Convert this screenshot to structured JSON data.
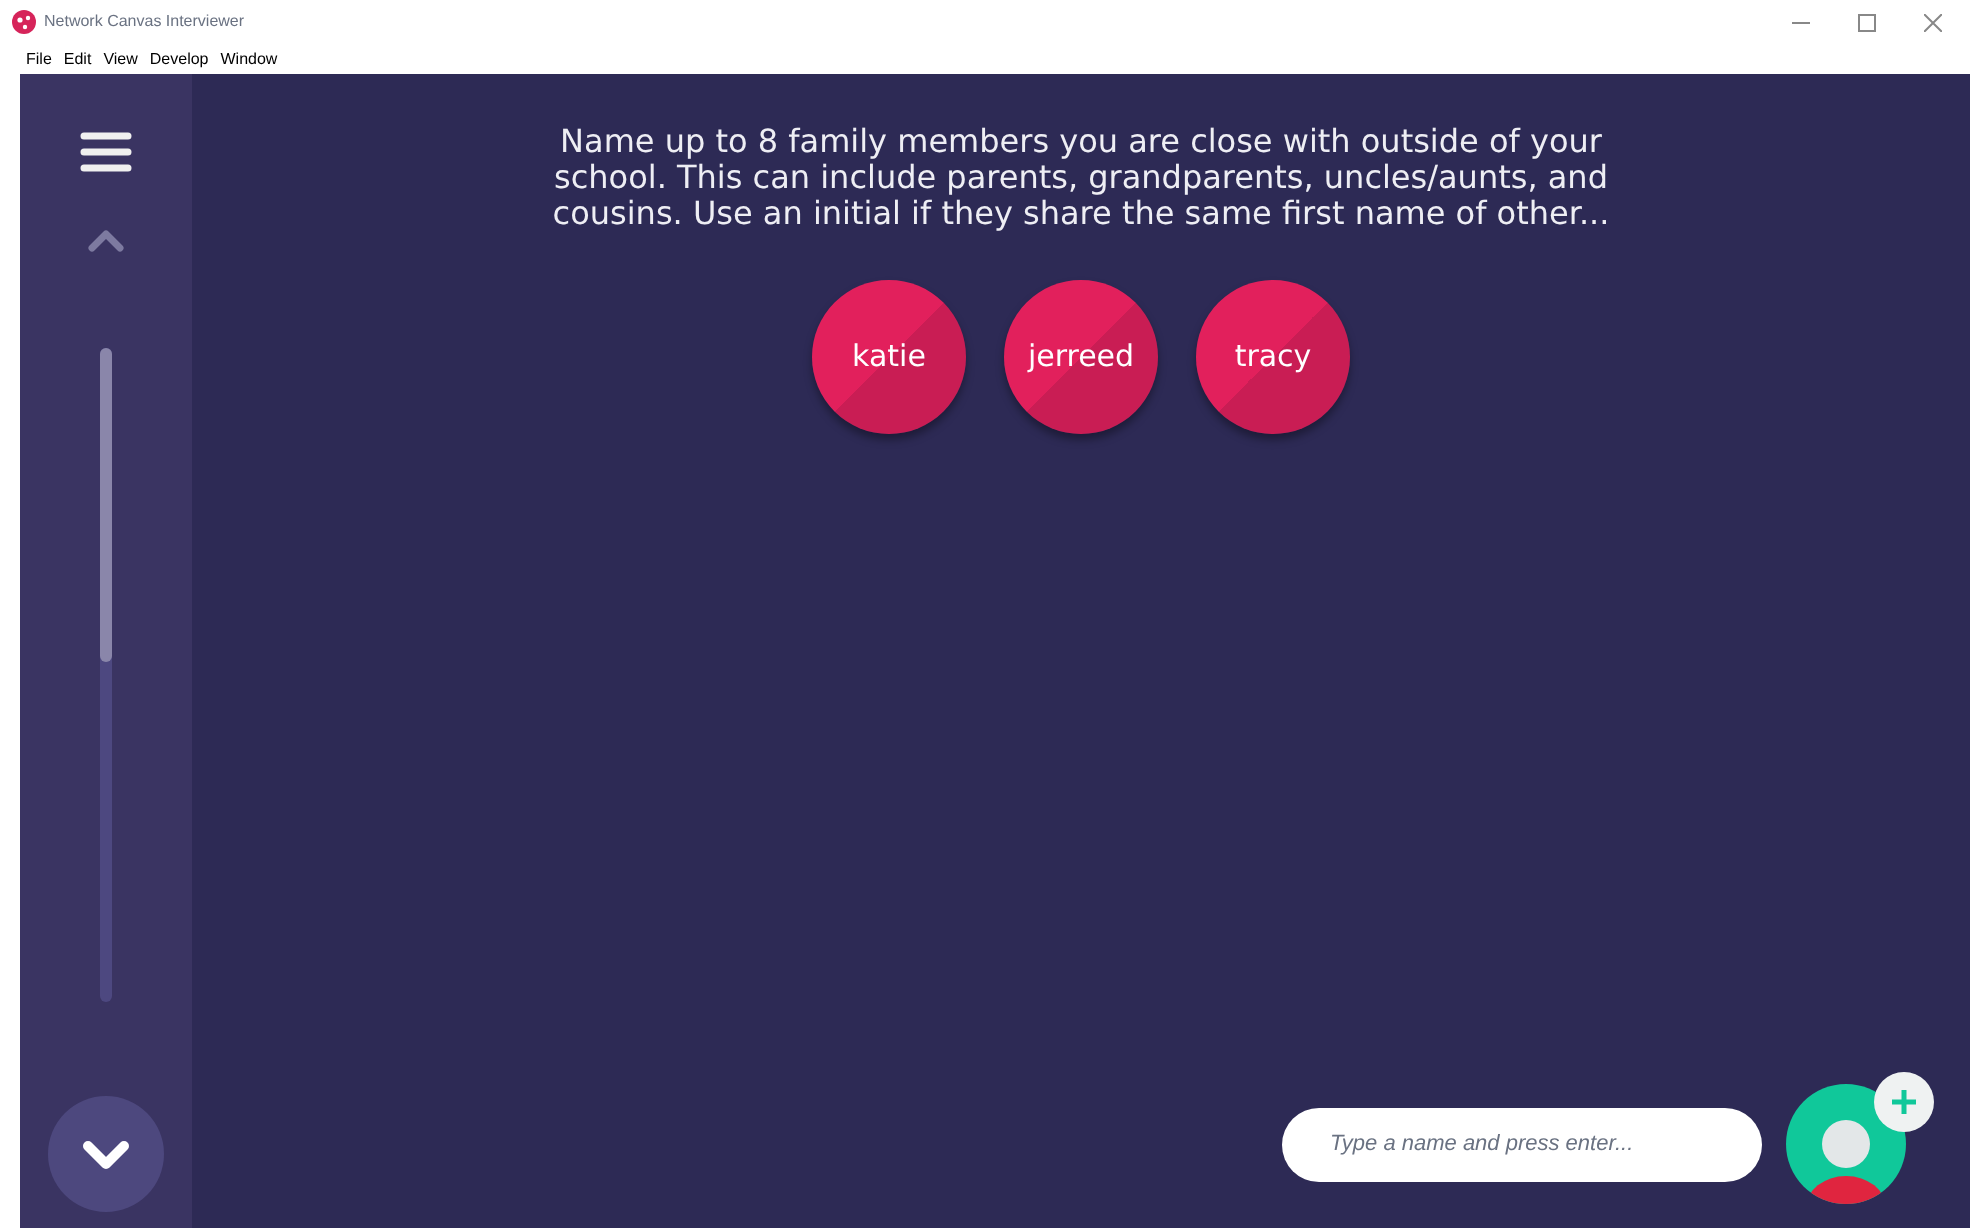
{
  "window": {
    "title": "Network Canvas Interviewer"
  },
  "menu": [
    "File",
    "Edit",
    "View",
    "Develop",
    "Window"
  ],
  "progress": {
    "level": 0.48
  },
  "prompt_lines": [
    "Name up to 8 family members you are close with outside of your",
    "school. This can include parents, grandparents, uncles/aunts, and",
    "cousins. Use an initial if they share the same first name of other..."
  ],
  "nodes": [
    {
      "label": "katie"
    },
    {
      "label": "jerreed"
    },
    {
      "label": "tracy"
    }
  ],
  "name_input": {
    "placeholder": "Type a name and press enter..."
  }
}
